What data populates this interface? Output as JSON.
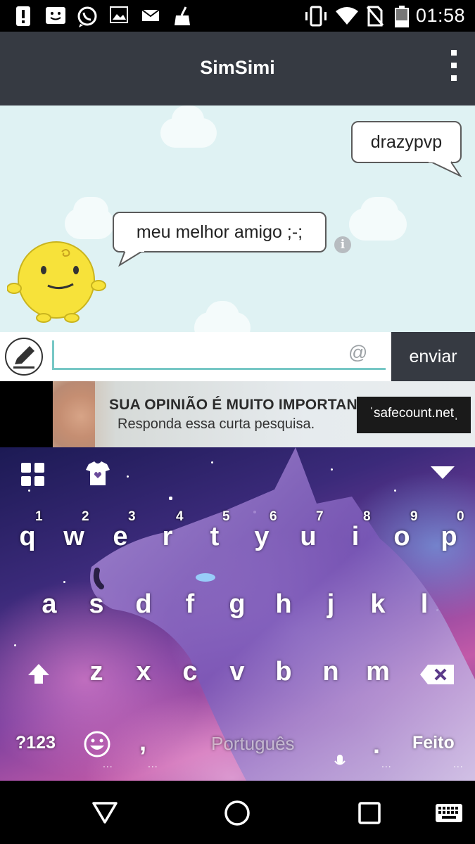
{
  "status_bar": {
    "time": "01:58",
    "left_icons": [
      "alert-icon",
      "sms-icon",
      "whatsapp-icon",
      "image-icon",
      "mail-icon",
      "cleaner-icon"
    ],
    "right_icons": [
      "vibrate-icon",
      "wifi-icon",
      "no-sim-icon",
      "battery-icon"
    ]
  },
  "app_bar": {
    "title": "SimSimi"
  },
  "chat": {
    "messages": [
      {
        "sender": "user",
        "text": "drazypvp"
      },
      {
        "sender": "bot",
        "text": "meu melhor amigo ;-;"
      }
    ]
  },
  "input": {
    "value": "",
    "at_symbol": "@",
    "send_label": "enviar"
  },
  "ad": {
    "line1": "SUA OPINIÃO É MUITO IMPORTANTE!",
    "line2": "Responda essa curta pesquisa.",
    "brand": "ˈsafecount.netˌ"
  },
  "keyboard": {
    "row1": [
      "q",
      "w",
      "e",
      "r",
      "t",
      "y",
      "u",
      "i",
      "o",
      "p"
    ],
    "numbers": [
      "1",
      "2",
      "3",
      "4",
      "5",
      "6",
      "7",
      "8",
      "9",
      "0"
    ],
    "row2": [
      "a",
      "s",
      "d",
      "f",
      "g",
      "h",
      "j",
      "k",
      "l"
    ],
    "row3": [
      "z",
      "x",
      "c",
      "v",
      "b",
      "n",
      "m"
    ],
    "symbols_label": "?123",
    "comma": ",",
    "space_label": "Português",
    "period": ".",
    "done_label": "Feito",
    "ellipsis": "..."
  },
  "colors": {
    "app_bar": "#363a42",
    "chat_bg": "#dff2f3",
    "accent": "#76c7c5",
    "send_button": "#363a42"
  }
}
